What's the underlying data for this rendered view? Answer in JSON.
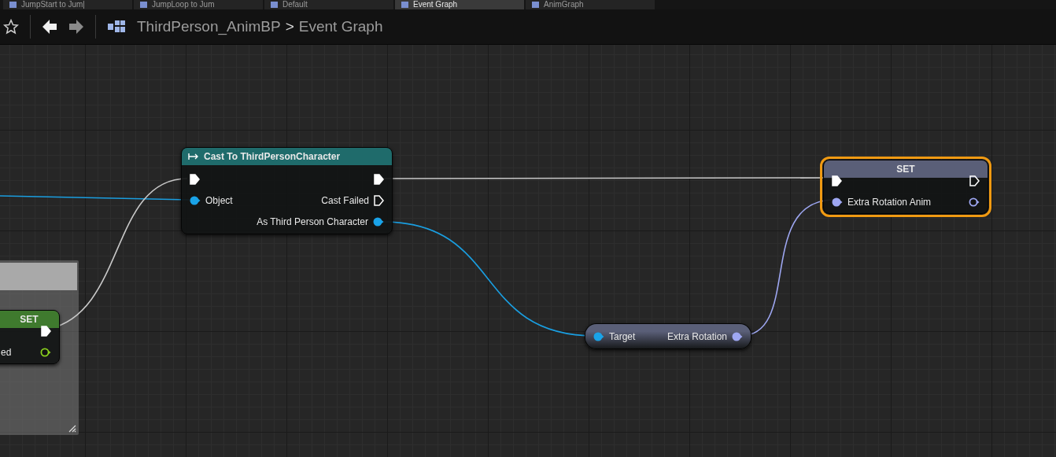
{
  "tabs": [
    {
      "label": "JumpStart to Jum|",
      "selected": false
    },
    {
      "label": "JumpLoop to Jum",
      "selected": false
    },
    {
      "label": "Default",
      "selected": false
    },
    {
      "label": "Event Graph",
      "selected": true
    },
    {
      "label": "AnimGraph",
      "selected": false
    }
  ],
  "breadcrumb": {
    "asset": "ThirdPerson_AnimBP",
    "separator": ">",
    "graph": "Event Graph"
  },
  "comment_box": {
    "kind": "comment"
  },
  "nodes": [
    {
      "kind": "set",
      "title": "SET",
      "color": "#3f7a2e",
      "selected": false,
      "rows": [
        {
          "right": {
            "kind": "exec",
            "connected": true
          }
        },
        {
          "left": {
            "label": "ed"
          },
          "right": {
            "kind": "bool",
            "connected": false
          }
        }
      ]
    },
    {
      "kind": "cast",
      "title": "Cast To ThirdPersonCharacter",
      "color": "#1f6b6b",
      "selected": false,
      "rows": [
        {
          "left": {
            "kind": "exec",
            "connected": true
          },
          "right": {
            "kind": "exec",
            "connected": true
          }
        },
        {
          "left": {
            "kind": "object",
            "connected": true,
            "label": "Object"
          },
          "right": {
            "kind": "exec",
            "connected": false,
            "label": "Cast Failed"
          }
        },
        {
          "right": {
            "kind": "object",
            "connected": true,
            "label": "As Third Person Character"
          }
        }
      ]
    },
    {
      "kind": "getter",
      "color": "#5a5f78",
      "selected": false,
      "rows": [
        {
          "left": {
            "kind": "object",
            "connected": true,
            "label": "Target"
          },
          "right": {
            "kind": "rotator",
            "connected": true,
            "label": "Extra Rotation"
          }
        }
      ]
    },
    {
      "kind": "set",
      "title": "SET",
      "color": "#5a5f78",
      "selected": true,
      "rows": [
        {
          "left": {
            "kind": "exec",
            "connected": true
          },
          "right": {
            "kind": "exec",
            "connected": false
          }
        },
        {
          "left": {
            "kind": "rotator",
            "connected": true,
            "label": "Extra Rotation Anim"
          },
          "right": {
            "kind": "rotator",
            "connected": false
          }
        }
      ]
    }
  ]
}
